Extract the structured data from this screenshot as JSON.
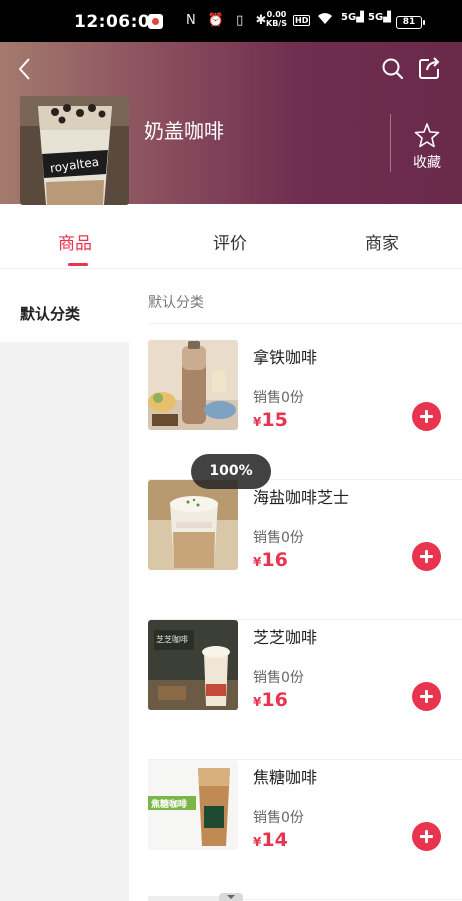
{
  "status_bar": {
    "time": "12:06:08",
    "system_icons": "N ⏰ ▯ ✱",
    "net_speed_value": "0.00",
    "net_speed_unit": "KB/S",
    "hd": "HD",
    "sig1": "5G",
    "sig2": "5G",
    "battery": "81"
  },
  "header": {
    "store_name": "奶盖咖啡",
    "favorite_label": "收藏"
  },
  "tabs": [
    {
      "label": "商品",
      "active": true
    },
    {
      "label": "评价",
      "active": false
    },
    {
      "label": "商家",
      "active": false
    }
  ],
  "sidebar": {
    "categories": [
      {
        "label": "默认分类",
        "selected": true
      }
    ]
  },
  "content": {
    "section_title": "默认分类",
    "products": [
      {
        "name": "拿铁咖啡",
        "sold": "销售0份",
        "currency": "¥",
        "price": "15"
      },
      {
        "name": "海盐咖啡芝士",
        "sold": "销售0份",
        "currency": "¥",
        "price": "16"
      },
      {
        "name": "芝芝咖啡",
        "sold": "销售0份",
        "currency": "¥",
        "price": "16"
      },
      {
        "name": "焦糖咖啡",
        "sold": "销售0份",
        "currency": "¥",
        "price": "14"
      }
    ]
  },
  "overlay": {
    "zoom_level": "100%"
  },
  "image_text": {
    "header_cup_brand": "royaltea",
    "product3_sign": "芝芝咖啡",
    "product4_tag": "焦糖咖啡"
  },
  "colors": {
    "accent": "#e8344e",
    "header_gradient_start": "#a47a6e",
    "header_gradient_end": "#6a2a4a"
  },
  "icons": [
    "back-arrow-icon",
    "search-icon",
    "share-icon",
    "star-icon",
    "plus-icon"
  ]
}
